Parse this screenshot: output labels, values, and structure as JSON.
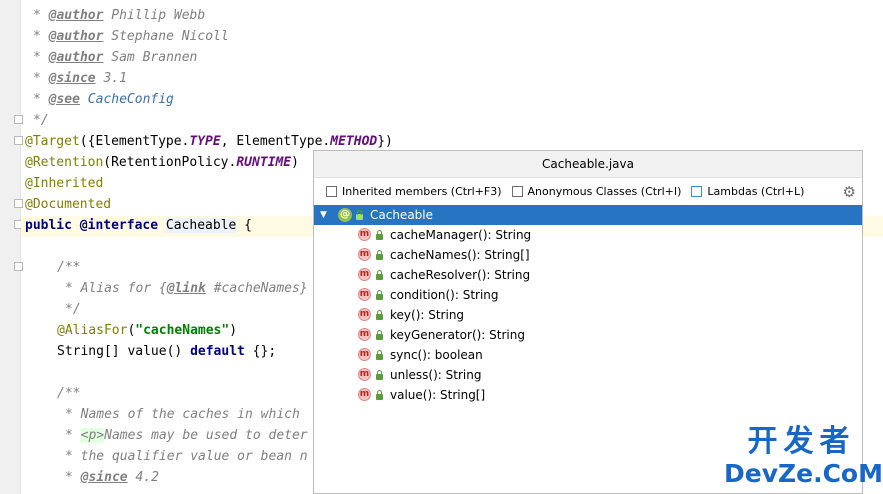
{
  "code": {
    "l1": [
      "* ",
      "@author",
      " Phillip Webb"
    ],
    "l2": [
      "* ",
      "@author",
      " Stephane Nicoll"
    ],
    "l3": [
      "* ",
      "@author",
      " Sam Brannen"
    ],
    "l4": [
      "* ",
      "@since",
      " 3.1"
    ],
    "l5": [
      "* ",
      "@see",
      " CacheConfig"
    ],
    "l6": "*/",
    "l7": {
      "a": "@Target",
      "b": "({ElementType.",
      "c": "TYPE",
      "d": ", ElementType.",
      "e": "METHOD",
      "f": "})"
    },
    "l8": {
      "a": "@Retention",
      "b": "(RetentionPolicy.",
      "c": "RUNTIME",
      "d": ")"
    },
    "l9": "@Inherited",
    "l10": "@Documented",
    "l11": {
      "a": "public",
      "b": " ",
      "c": "@interface",
      "d": " ",
      "e": "Cacheable",
      "f": " {"
    },
    "l13": "/**",
    "l14": {
      "a": "* Alias for {",
      "b": "@link",
      "c": " #cacheNames}"
    },
    "l15": "*/",
    "l16": {
      "a": "@AliasFor",
      "b": "(",
      "c": "\"cacheNames\"",
      "d": ")"
    },
    "l17": {
      "a": "String[] value() ",
      "b": "default",
      "c": " {};"
    },
    "l19": "/**",
    "l20": "* Names of the caches in which",
    "l21": {
      "a": "* ",
      "b": "<p>",
      "c": "Names may be used to deter"
    },
    "l22": "* the qualifier value or bean n",
    "l23": {
      "a": "* ",
      "b": "@since",
      "c": " 4.2"
    }
  },
  "popup": {
    "title": "Cacheable.java",
    "options": [
      {
        "label": "Inherited members (Ctrl+F3)",
        "checked": false
      },
      {
        "label": "Anonymous Classes (Ctrl+I)",
        "checked": false
      },
      {
        "label": "Lambdas (Ctrl+L)",
        "checked": false
      }
    ],
    "root": {
      "label": "Cacheable",
      "icon": "annotation-icon"
    },
    "members": [
      "cacheManager(): String",
      "cacheNames(): String[]",
      "cacheResolver(): String",
      "condition(): String",
      "key(): String",
      "keyGenerator(): String",
      "sync(): boolean",
      "unless(): String",
      "value(): String[]"
    ],
    "method_icon_letter": "m",
    "root_icon_letter": "@"
  },
  "watermark": {
    "cn": "开发者",
    "en": "DevZe.CoM"
  }
}
